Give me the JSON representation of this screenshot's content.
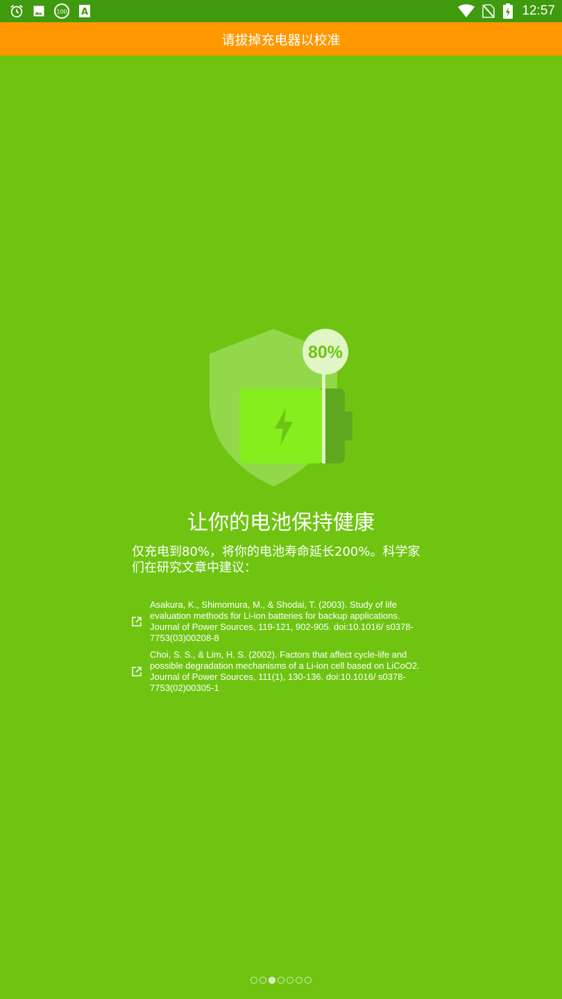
{
  "status_bar": {
    "time": "12:57",
    "left_icons": [
      "alarm-icon",
      "image-icon",
      "battery-100-badge-icon",
      "font-a-icon"
    ],
    "right_icons": [
      "wifi-icon",
      "no-sim-icon",
      "battery-charging-icon"
    ],
    "badge_text": "100",
    "font_icon_text": "A"
  },
  "banner": {
    "text": "请拔掉充电器以校准",
    "color": "#ff9800"
  },
  "illustration": {
    "percent_label": "80%",
    "charge_level": 0.8
  },
  "content": {
    "headline": "让你的电池保持健康",
    "description": "仅充电到80%，将你的电池寿命延长200%。科学家们在研究文章中建议："
  },
  "references": [
    {
      "icon": "external-link-icon",
      "text": "Asakura, K., Shimomura, M., & Shodai, T. (2003). Study of life evaluation methods for Li-ion batteries for backup applications. Journal of Power Sources, 119-121, 902-905. doi:10.1016/ s0378-7753(03)00208-8"
    },
    {
      "icon": "external-link-icon",
      "text": "Choi, S. S., & Lim, H. S. (2002). Factors that affect cycle-life and possible degradation mechanisms of a Li-ion cell based on LiCoO2. Journal of Power Sources, 111(1), 130-136. doi:10.1016/ s0378-7753(02)00305-1"
    }
  ],
  "pager": {
    "count": 7,
    "active_index": 2
  },
  "colors": {
    "background": "#6fc412",
    "status_bar": "#3f9a0e",
    "battery_fill": "#86ee1d",
    "battery_empty": "#5ea81f"
  }
}
